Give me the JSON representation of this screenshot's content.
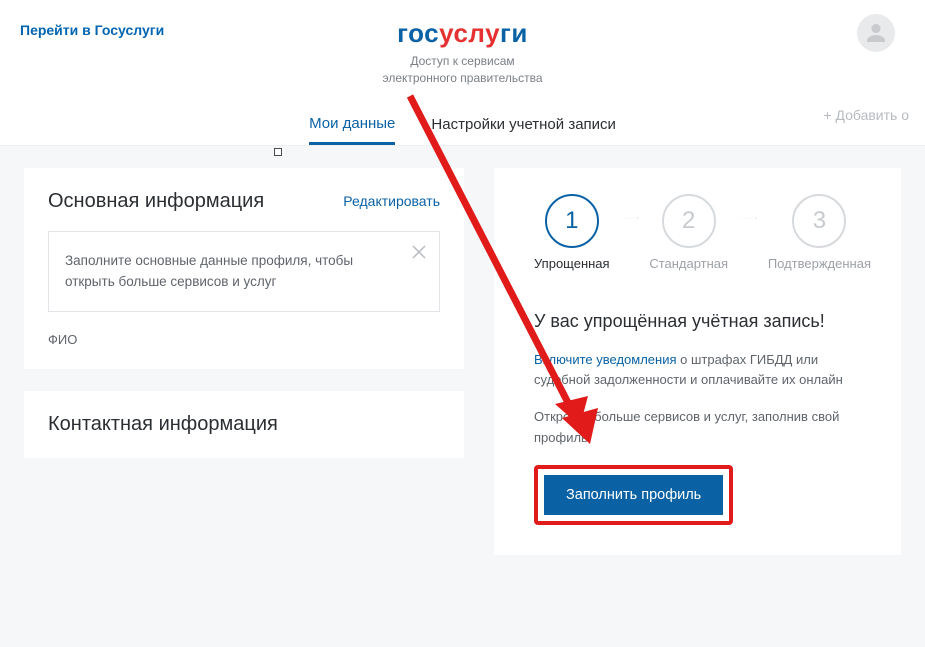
{
  "header": {
    "goto_link": "Перейти в Госуслуги",
    "logo_p1": "гос",
    "logo_p2": "услу",
    "logo_p3": "ги",
    "subtitle_line1": "Доступ к сервисам",
    "subtitle_line2": "электронного правительства"
  },
  "tabs": {
    "my_data": "Мои данные",
    "settings": "Настройки учетной записи",
    "add": "+ Добавить о"
  },
  "left": {
    "main_info_title": "Основная информация",
    "edit": "Редактировать",
    "notice": "Заполните основные данные профиля, чтобы открыть больше сервисов и услуг",
    "fio": "ФИО",
    "contact_title": "Контактная информация"
  },
  "right": {
    "steps": [
      {
        "num": "1",
        "label": "Упрощенная"
      },
      {
        "num": "2",
        "label": "Стандартная"
      },
      {
        "num": "3",
        "label": "Подтвержденная"
      }
    ],
    "status_title": "У вас упрощённая учётная запись!",
    "notify_link": "Включите уведомления",
    "notify_rest": " о штрафах ГИБДД или судебной задолженности и оплачивайте их онлайн",
    "open_more": "Откройте больше сервисов и услуг, заполнив свой профиль.",
    "fill_button": "Заполнить профиль"
  }
}
